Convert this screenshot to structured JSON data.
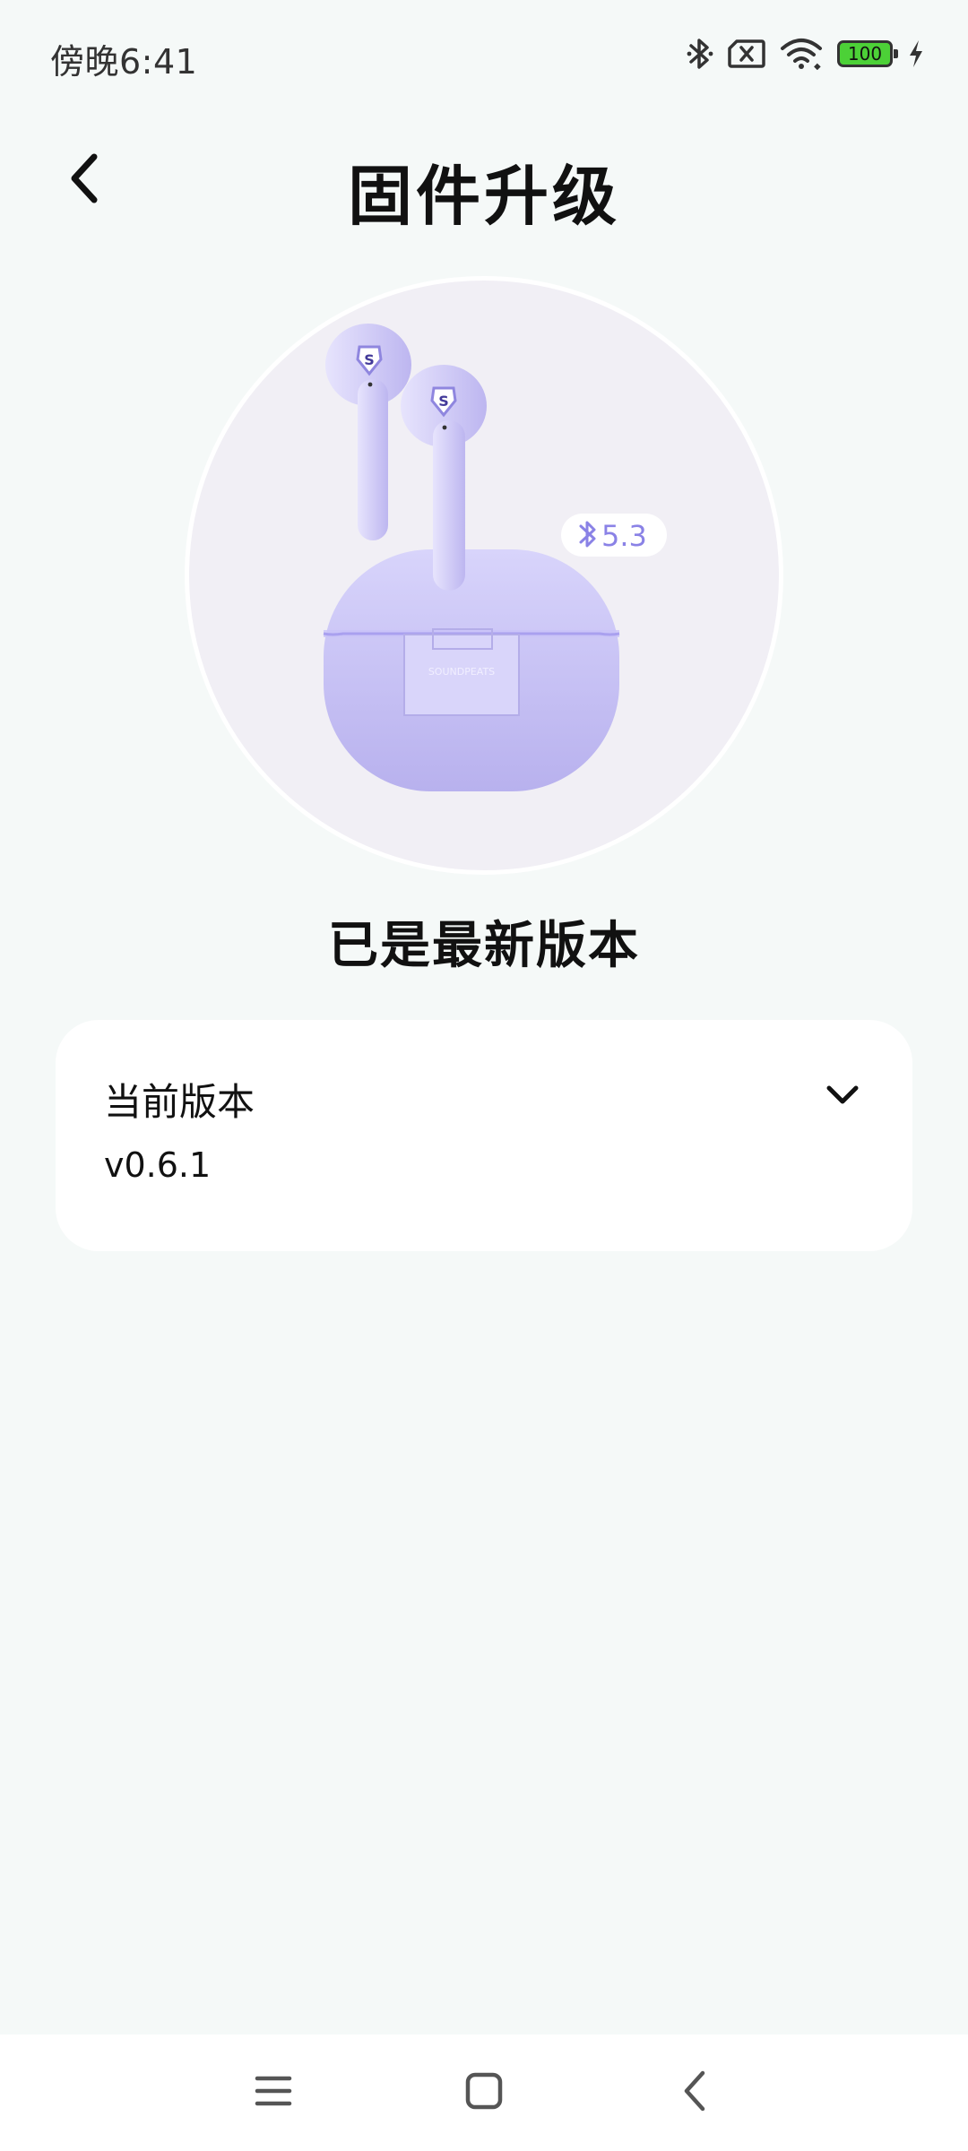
{
  "status_bar": {
    "time": "傍晚6:41",
    "battery": "100",
    "icons": [
      "bluetooth-icon",
      "sim-error-icon",
      "wifi-icon",
      "battery-icon",
      "charging-icon"
    ]
  },
  "header": {
    "title": "固件升级",
    "back_icon": "chevron-left-icon"
  },
  "product": {
    "bluetooth_version": "5.3",
    "case_brand": "SOUNDPEATS"
  },
  "update_status": "已是最新版本",
  "version_card": {
    "label": "当前版本",
    "value": "v0.6.1",
    "toggle_icon": "chevron-down-icon"
  },
  "nav_bar": {
    "items": [
      "menu-icon",
      "home-icon",
      "back-icon"
    ]
  },
  "colors": {
    "background": "#f5f9f8",
    "card": "#ffffff",
    "product_circle": "#f1eff5",
    "earbud": "#c8c3f2",
    "battery_fill": "#4cd137"
  }
}
